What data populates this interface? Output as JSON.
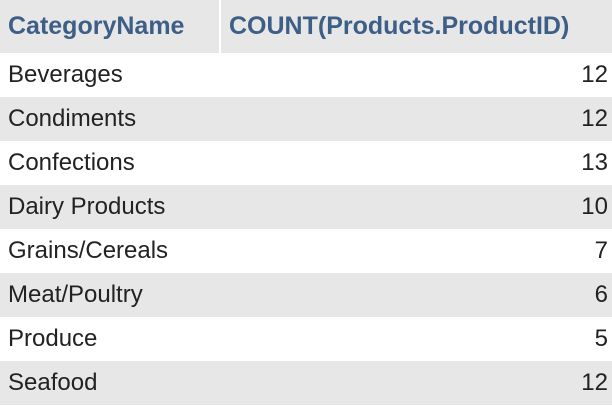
{
  "table": {
    "headers": [
      "CategoryName",
      "COUNT(Products.ProductID)"
    ],
    "rows": [
      [
        "Beverages",
        "12"
      ],
      [
        "Condiments",
        "12"
      ],
      [
        "Confections",
        "13"
      ],
      [
        "Dairy Products",
        "10"
      ],
      [
        "Grains/Cereals",
        "7"
      ],
      [
        "Meat/Poultry",
        "6"
      ],
      [
        "Produce",
        "5"
      ],
      [
        "Seafood",
        "12"
      ]
    ]
  }
}
